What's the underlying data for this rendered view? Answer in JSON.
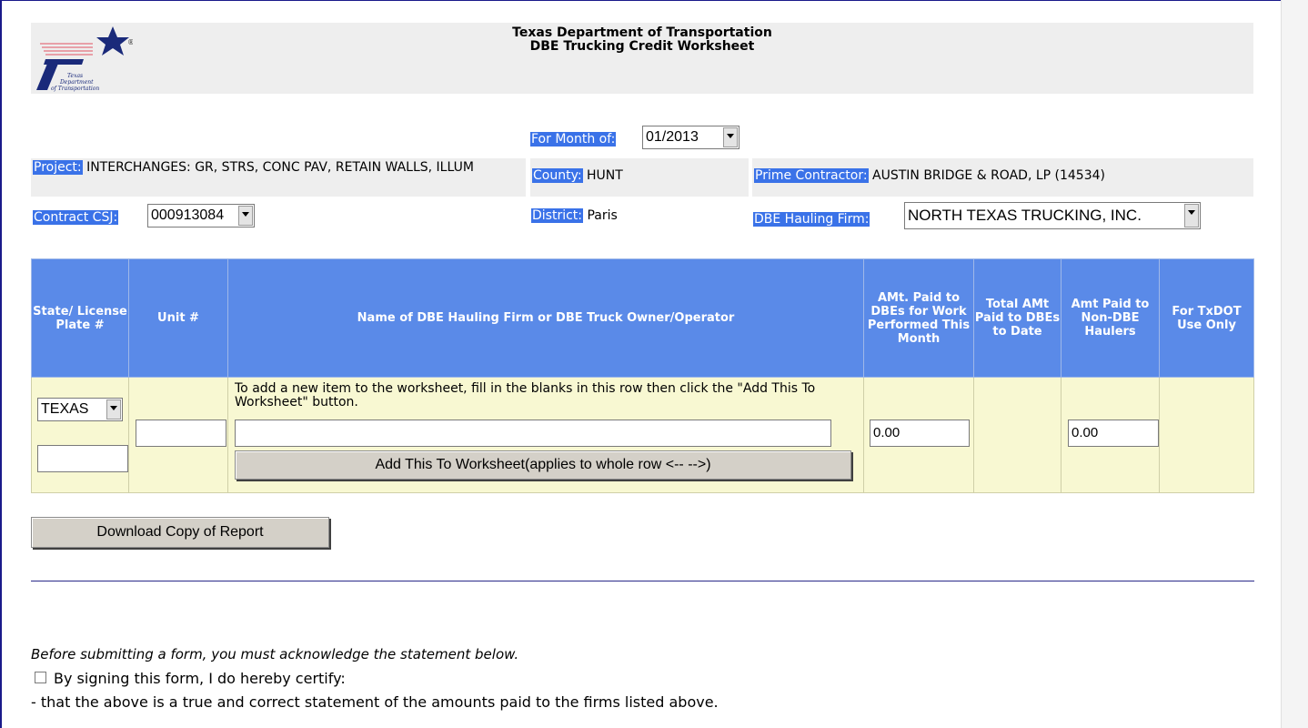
{
  "header": {
    "title_line1": "Texas Department of Transportation",
    "title_line2": "DBE Trucking Credit Worksheet",
    "logo_text": "Texas Department of Transportation",
    "logo_registered": "®"
  },
  "info": {
    "month_label": "For Month of:",
    "month_value": "01/2013",
    "project_label": "Project:",
    "project_value": "INTERCHANGES: GR, STRS, CONC PAV, RETAIN WALLS, ILLUM",
    "county_label": "County:",
    "county_value": "HUNT",
    "prime_label": "Prime Contractor:",
    "prime_value": "AUSTIN BRIDGE & ROAD, LP (14534)",
    "csj_label": "Contract CSJ:",
    "csj_value": "000913084",
    "district_label": "District:",
    "district_value": "Paris",
    "hauling_label": "DBE Hauling Firm:",
    "hauling_value": "NORTH TEXAS TRUCKING, INC."
  },
  "table": {
    "headers": [
      "State/ License Plate #",
      "Unit #",
      "Name of DBE Hauling Firm or DBE Truck Owner/Operator",
      "AMt. Paid to DBEs for Work Performed This Month",
      "Total AMt Paid to DBEs to Date",
      "Amt Paid to Non-DBE Haulers",
      "For TxDOT Use Only"
    ],
    "state_value": "TEXAS",
    "instruction": "To add a new item to the worksheet, fill in the blanks in this row then click the \"Add This To Worksheet\" button.",
    "amt_month_value": "0.00",
    "amt_non_dbe_value": "0.00",
    "add_button_label": "Add This To Worksheet(applies to whole row <-- -->)"
  },
  "download_button_label": "Download Copy of Report",
  "acknowledge_text": "Before submitting a form, you must acknowledge the statement below.",
  "certify_label": "By signing this form, I do hereby certify:",
  "statement": "- that the above is a true and correct statement of the amounts paid to the firms listed above.",
  "colors": {
    "label_bg": "#3a72e8",
    "header_bg": "#5a8ae8",
    "row_bg": "#f8f8d2"
  }
}
